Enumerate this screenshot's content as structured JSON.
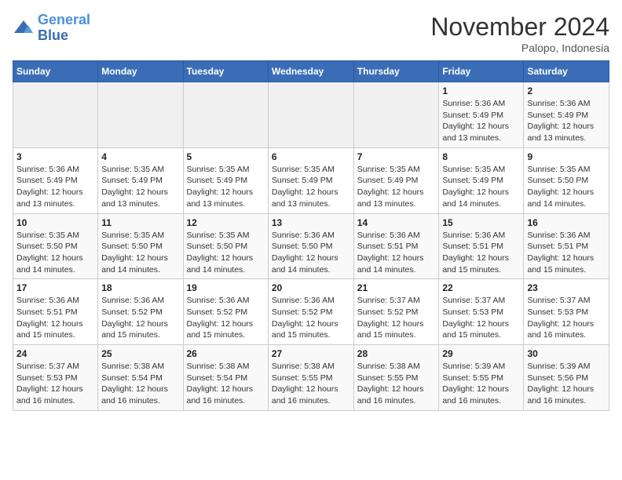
{
  "logo": {
    "text_general": "General",
    "text_blue": "Blue"
  },
  "title": "November 2024",
  "location": "Palopo, Indonesia",
  "weekdays": [
    "Sunday",
    "Monday",
    "Tuesday",
    "Wednesday",
    "Thursday",
    "Friday",
    "Saturday"
  ],
  "weeks": [
    [
      {
        "day": "",
        "info": ""
      },
      {
        "day": "",
        "info": ""
      },
      {
        "day": "",
        "info": ""
      },
      {
        "day": "",
        "info": ""
      },
      {
        "day": "",
        "info": ""
      },
      {
        "day": "1",
        "info": "Sunrise: 5:36 AM\nSunset: 5:49 PM\nDaylight: 12 hours\nand 13 minutes."
      },
      {
        "day": "2",
        "info": "Sunrise: 5:36 AM\nSunset: 5:49 PM\nDaylight: 12 hours\nand 13 minutes."
      }
    ],
    [
      {
        "day": "3",
        "info": "Sunrise: 5:36 AM\nSunset: 5:49 PM\nDaylight: 12 hours\nand 13 minutes."
      },
      {
        "day": "4",
        "info": "Sunrise: 5:35 AM\nSunset: 5:49 PM\nDaylight: 12 hours\nand 13 minutes."
      },
      {
        "day": "5",
        "info": "Sunrise: 5:35 AM\nSunset: 5:49 PM\nDaylight: 12 hours\nand 13 minutes."
      },
      {
        "day": "6",
        "info": "Sunrise: 5:35 AM\nSunset: 5:49 PM\nDaylight: 12 hours\nand 13 minutes."
      },
      {
        "day": "7",
        "info": "Sunrise: 5:35 AM\nSunset: 5:49 PM\nDaylight: 12 hours\nand 13 minutes."
      },
      {
        "day": "8",
        "info": "Sunrise: 5:35 AM\nSunset: 5:49 PM\nDaylight: 12 hours\nand 14 minutes."
      },
      {
        "day": "9",
        "info": "Sunrise: 5:35 AM\nSunset: 5:50 PM\nDaylight: 12 hours\nand 14 minutes."
      }
    ],
    [
      {
        "day": "10",
        "info": "Sunrise: 5:35 AM\nSunset: 5:50 PM\nDaylight: 12 hours\nand 14 minutes."
      },
      {
        "day": "11",
        "info": "Sunrise: 5:35 AM\nSunset: 5:50 PM\nDaylight: 12 hours\nand 14 minutes."
      },
      {
        "day": "12",
        "info": "Sunrise: 5:35 AM\nSunset: 5:50 PM\nDaylight: 12 hours\nand 14 minutes."
      },
      {
        "day": "13",
        "info": "Sunrise: 5:36 AM\nSunset: 5:50 PM\nDaylight: 12 hours\nand 14 minutes."
      },
      {
        "day": "14",
        "info": "Sunrise: 5:36 AM\nSunset: 5:51 PM\nDaylight: 12 hours\nand 14 minutes."
      },
      {
        "day": "15",
        "info": "Sunrise: 5:36 AM\nSunset: 5:51 PM\nDaylight: 12 hours\nand 15 minutes."
      },
      {
        "day": "16",
        "info": "Sunrise: 5:36 AM\nSunset: 5:51 PM\nDaylight: 12 hours\nand 15 minutes."
      }
    ],
    [
      {
        "day": "17",
        "info": "Sunrise: 5:36 AM\nSunset: 5:51 PM\nDaylight: 12 hours\nand 15 minutes."
      },
      {
        "day": "18",
        "info": "Sunrise: 5:36 AM\nSunset: 5:52 PM\nDaylight: 12 hours\nand 15 minutes."
      },
      {
        "day": "19",
        "info": "Sunrise: 5:36 AM\nSunset: 5:52 PM\nDaylight: 12 hours\nand 15 minutes."
      },
      {
        "day": "20",
        "info": "Sunrise: 5:36 AM\nSunset: 5:52 PM\nDaylight: 12 hours\nand 15 minutes."
      },
      {
        "day": "21",
        "info": "Sunrise: 5:37 AM\nSunset: 5:52 PM\nDaylight: 12 hours\nand 15 minutes."
      },
      {
        "day": "22",
        "info": "Sunrise: 5:37 AM\nSunset: 5:53 PM\nDaylight: 12 hours\nand 15 minutes."
      },
      {
        "day": "23",
        "info": "Sunrise: 5:37 AM\nSunset: 5:53 PM\nDaylight: 12 hours\nand 16 minutes."
      }
    ],
    [
      {
        "day": "24",
        "info": "Sunrise: 5:37 AM\nSunset: 5:53 PM\nDaylight: 12 hours\nand 16 minutes."
      },
      {
        "day": "25",
        "info": "Sunrise: 5:38 AM\nSunset: 5:54 PM\nDaylight: 12 hours\nand 16 minutes."
      },
      {
        "day": "26",
        "info": "Sunrise: 5:38 AM\nSunset: 5:54 PM\nDaylight: 12 hours\nand 16 minutes."
      },
      {
        "day": "27",
        "info": "Sunrise: 5:38 AM\nSunset: 5:55 PM\nDaylight: 12 hours\nand 16 minutes."
      },
      {
        "day": "28",
        "info": "Sunrise: 5:38 AM\nSunset: 5:55 PM\nDaylight: 12 hours\nand 16 minutes."
      },
      {
        "day": "29",
        "info": "Sunrise: 5:39 AM\nSunset: 5:55 PM\nDaylight: 12 hours\nand 16 minutes."
      },
      {
        "day": "30",
        "info": "Sunrise: 5:39 AM\nSunset: 5:56 PM\nDaylight: 12 hours\nand 16 minutes."
      }
    ]
  ]
}
